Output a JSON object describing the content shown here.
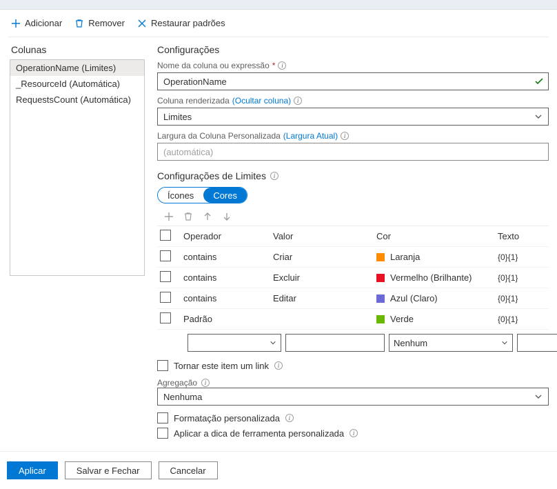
{
  "toolbar": {
    "add": "Adicionar",
    "remove": "Remover",
    "restore": "Restaurar padrões"
  },
  "left": {
    "title": "Colunas",
    "items": [
      {
        "label": "OperationName (Limites)",
        "selected": true
      },
      {
        "label": "_ResourceId (Automática)",
        "selected": false
      },
      {
        "label": "RequestsCount (Automática)",
        "selected": false
      }
    ]
  },
  "settings": {
    "title": "Configurações",
    "name_label": "Nome da coluna ou expressão",
    "name_value": "OperationName",
    "renderer_label": "Coluna renderizada",
    "renderer_link": "(Ocultar coluna)",
    "renderer_value": "Limites",
    "width_label": "Largura da Coluna Personalizada",
    "width_link": "(Largura Atual)",
    "width_placeholder": "(automática)"
  },
  "thresholds": {
    "title": "Configurações de Limites",
    "seg_icons": "Ícones",
    "seg_colors": "Cores",
    "headers": {
      "operator": "Operador",
      "value": "Valor",
      "color": "Cor",
      "text": "Texto"
    },
    "rows": [
      {
        "operator": "contains",
        "value": "Criar",
        "color_label": "Laranja",
        "swatch": "#ff8c00",
        "text": "{0}{1}"
      },
      {
        "operator": "contains",
        "value": "Excluir",
        "color_label": "Vermelho (Brilhante)",
        "swatch": "#e81123",
        "text": "{0}{1}"
      },
      {
        "operator": "contains",
        "value": "Editar",
        "color_label": "Azul (Claro)",
        "swatch": "#6b69d6",
        "text": "{0}{1}"
      },
      {
        "operator": "Padrão",
        "value": "",
        "color_label": "Verde",
        "swatch": "#6bb700",
        "text": "{0}{1}"
      }
    ],
    "new_row_color": "Nenhum"
  },
  "options": {
    "make_link": "Tornar este item um link",
    "agg_label": "Agregação",
    "agg_value": "Nenhuma",
    "custom_format": "Formatação personalizada",
    "custom_tooltip": "Aplicar a dica de ferramenta personalizada"
  },
  "footer": {
    "apply": "Aplicar",
    "save_close": "Salvar e Fechar",
    "cancel": "Cancelar"
  }
}
